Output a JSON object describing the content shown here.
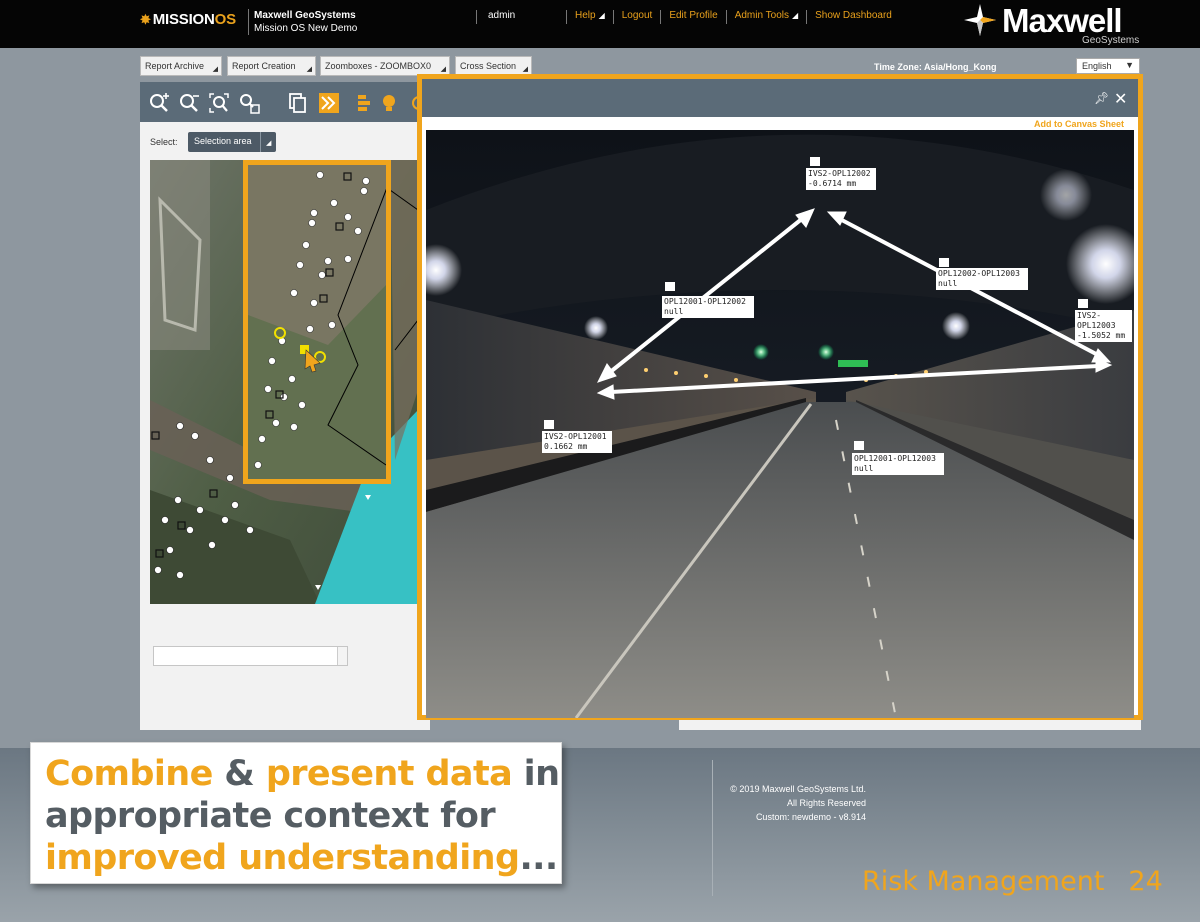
{
  "header": {
    "logo_prefix": "MISSION",
    "logo_suffix": "OS",
    "org_name": "Maxwell GeoSystems",
    "project_name": "Mission OS New Demo",
    "user": "admin",
    "links": [
      "Help",
      "Logout",
      "Edit Profile",
      "Admin Tools",
      "Show Dashboard"
    ],
    "links_with_dropdown": [
      "Help",
      "Admin Tools"
    ],
    "brand_name": "Maxwell",
    "brand_sub": "GeoSystems"
  },
  "toolbar": {
    "menus": [
      "Report Archive",
      "Report Creation",
      "Zoomboxes - ZOOMBOX0",
      "Cross Section"
    ],
    "timezone": "Time Zone: Asia/Hong_Kong",
    "language": "English"
  },
  "left_panel": {
    "tools": [
      "zoom-in-icon",
      "zoom-out-icon",
      "zoom-extent-icon",
      "pan-select-icon",
      "copy-icon",
      "fast-forward-icon",
      "layers-icon",
      "bulb-icon"
    ],
    "select_label": "Select:",
    "select_value": "Selection area"
  },
  "popup": {
    "add_to_canvas": "Add to Canvas Sheet",
    "tags": [
      {
        "lines": [
          "IVS2-OPL12002",
          "-0.6714 mm"
        ]
      },
      {
        "lines": [
          "OPL12002-OPL12003",
          "null"
        ]
      },
      {
        "lines": [
          "OPL12001-OPL12002",
          "null"
        ]
      },
      {
        "lines": [
          "IVS2-",
          "OPL12003",
          "-1.5052 mm"
        ]
      },
      {
        "lines": [
          "IVS2-OPL12001",
          "0.1662 mm"
        ]
      },
      {
        "lines": [
          "OPL12001-OPL12003",
          "null"
        ]
      }
    ]
  },
  "footer": {
    "tagline": {
      "w1": "Combine",
      "w2": " & ",
      "w3": "present data",
      "w4": " in",
      "w5": "appropriate context for",
      "w6": "improved understanding",
      "w7": "..."
    },
    "copyright": [
      "© 2019 Maxwell GeoSystems Ltd.",
      "All Rights Reserved",
      "Custom: newdemo - v8.914"
    ],
    "slide_title": "Risk Management",
    "slide_number": "24"
  },
  "colors": {
    "accent": "#f0a51d",
    "header_bg": "#050505",
    "panel_bar": "#5b6b78",
    "tagline_text": "#555d63"
  }
}
